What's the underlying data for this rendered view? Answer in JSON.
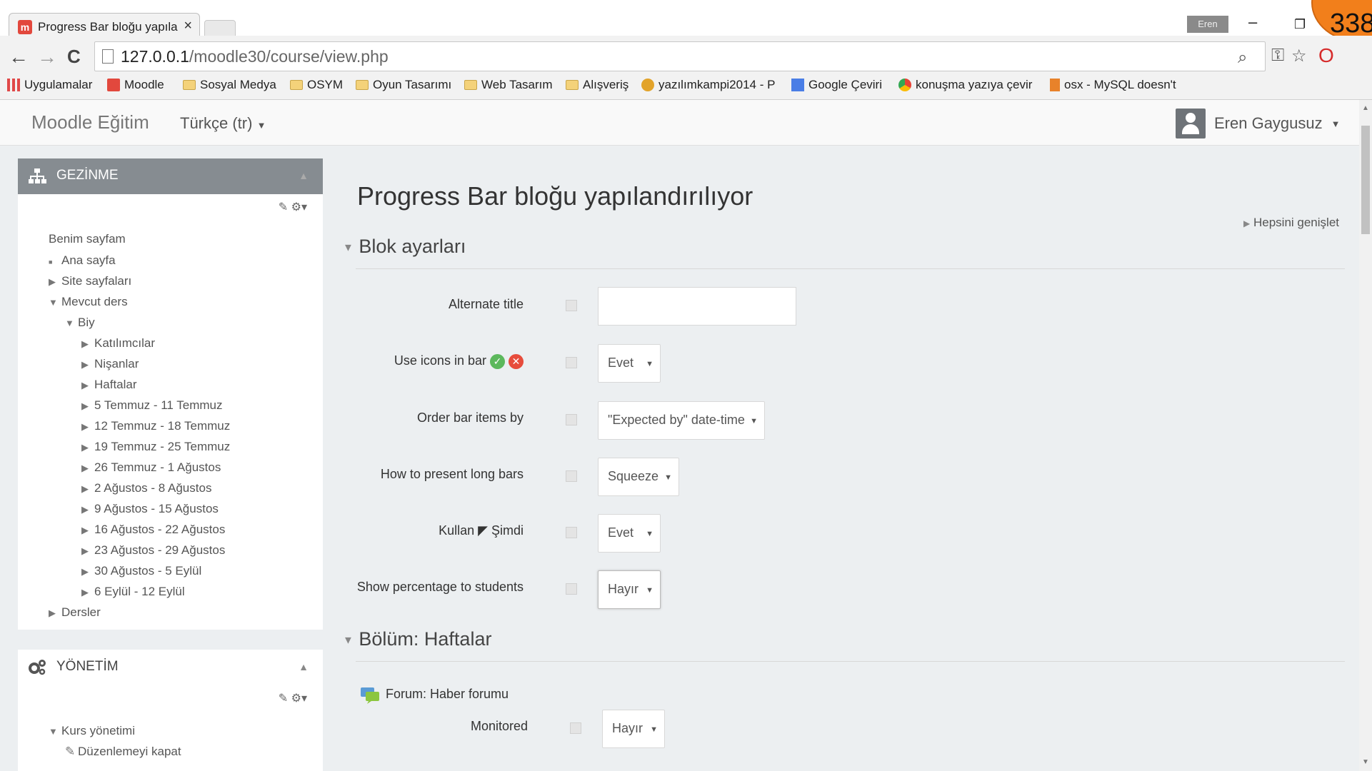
{
  "browser": {
    "tab_title": "Progress Bar bloğu yapıla",
    "tab_close": "×",
    "user_chip": "Eren",
    "minimize": "–",
    "restore": "❐",
    "badge_number": "338",
    "back": "←",
    "forward": "→",
    "reload": "C",
    "url_host": "127.0.0.1",
    "url_path": "/moodle30/course/view.php"
  },
  "bookmarks": [
    {
      "label": "Uygulamalar"
    },
    {
      "label": "Moodle"
    },
    {
      "label": "Sosyal Medya"
    },
    {
      "label": "OSYM"
    },
    {
      "label": "Oyun Tasarımı"
    },
    {
      "label": "Web Tasarım"
    },
    {
      "label": "Alışveriş"
    },
    {
      "label": "yazılımkampi2014 - P"
    },
    {
      "label": "Google Çeviri"
    },
    {
      "label": "konuşma yazıya çevir"
    },
    {
      "label": "osx - MySQL doesn't"
    }
  ],
  "navbar": {
    "brand": "Moodle Eğitim",
    "language": "Türkçe (tr)",
    "user_name": "Eren Gaygusuz"
  },
  "nav_block": {
    "title": "GEZİNME",
    "items": [
      "Benim sayfam",
      "Ana sayfa",
      "Site sayfaları",
      "Mevcut ders",
      "Biy",
      "Katılımcılar",
      "Nişanlar",
      "Haftalar",
      "5 Temmuz - 11 Temmuz",
      "12 Temmuz - 18 Temmuz",
      "19 Temmuz - 25 Temmuz",
      "26 Temmuz - 1 Ağustos",
      "2 Ağustos - 8 Ağustos",
      "9 Ağustos - 15 Ağustos",
      "16 Ağustos - 22 Ağustos",
      "23 Ağustos - 29 Ağustos",
      "30 Ağustos - 5 Eylül",
      "6 Eylül - 12 Eylül",
      "Dersler"
    ]
  },
  "admin_block": {
    "title": "YÖNETİM",
    "items": [
      "Kurs yönetimi",
      "Düzenlemeyi kapat"
    ]
  },
  "main": {
    "title": "Progress Bar bloğu yapılandırılıyor",
    "expand_all": "Hepsini genişlet",
    "section_block_settings": "Blok ayarları",
    "section_weeks": "Bölüm: Haftalar",
    "fields": {
      "alternate_title": {
        "label": "Alternate title",
        "value": ""
      },
      "use_icons": {
        "label": "Use icons in bar",
        "value": "Evet"
      },
      "order_by": {
        "label": "Order bar items by",
        "value": "\"Expected by\" date-time"
      },
      "long_bars": {
        "label": "How to present long bars",
        "value": "Squeeze"
      },
      "now": {
        "label": "Kullan ◤ Şimdi",
        "value": "Evet"
      },
      "show_pct": {
        "label": "Show percentage to students",
        "value": "Hayır"
      },
      "monitored": {
        "label": "Monitored",
        "value": "Hayır"
      }
    },
    "forum_label": "Forum: Haber forumu"
  }
}
